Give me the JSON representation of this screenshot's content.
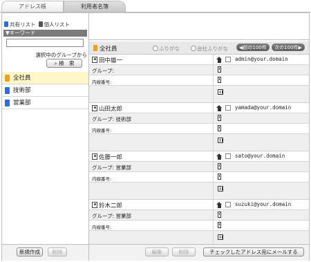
{
  "tabs": [
    "アドレス帳",
    "利用者名簿"
  ],
  "sidebar": {
    "shared_list": "共有リスト",
    "personal_list": "個人リスト",
    "keyword_header": "▼キーワード",
    "keyword_value": "",
    "group_filter_label": "選択中のグループから",
    "search_button": "検　索",
    "groups": [
      "全社員",
      "技術部",
      "営業部"
    ],
    "selected_group": "全社員",
    "new_button": "新規作成",
    "delete_button": "削除"
  },
  "main": {
    "header_title": "全社員",
    "radio_furigana": "ふりがな",
    "radio_company_furigana": "会社ふりがな",
    "prev_button": "前の100件",
    "next_button": "次の100件",
    "group_label": "グループ:",
    "ext_label": "内線番号:",
    "contacts": [
      {
        "name": "田中雄一",
        "group": "",
        "email": "admin@your.domain"
      },
      {
        "name": "山田太郎",
        "group": "技術部",
        "email": "yamada@your.domain"
      },
      {
        "name": "佐藤一郎",
        "group": "営業部",
        "email": "sato@your.domain"
      },
      {
        "name": "鈴木二郎",
        "group": "営業部",
        "email": "suzuki@your.domain"
      }
    ],
    "edit_button": "編集",
    "delete_button": "削除",
    "mail_checked_button": "チェックしたアドレス宛にメールする"
  },
  "colors": {
    "accent_orange": "#f0a020",
    "shared_icon": "#2a6fd6",
    "selected_row": "#fff7c8"
  }
}
